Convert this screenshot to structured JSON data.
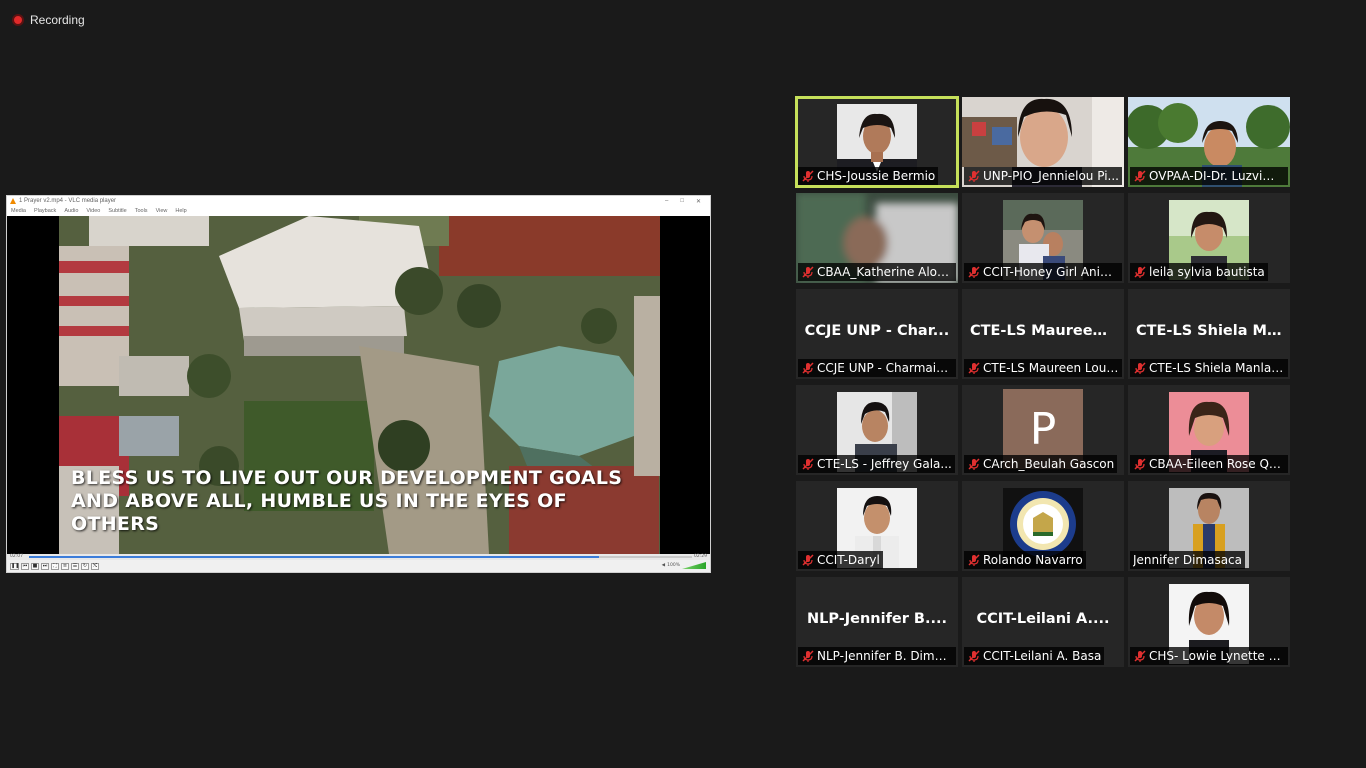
{
  "recording": {
    "label": "Recording"
  },
  "vlc": {
    "title": "1 Prayer v2.mp4 - VLC media player",
    "menus": [
      "Media",
      "Playback",
      "Audio",
      "Video",
      "Subtitle",
      "Tools",
      "View",
      "Help"
    ],
    "time_elapsed": "02:07",
    "time_total": "02:29",
    "progress_fraction": 0.86,
    "volume": "100%",
    "subtitle_line1": "BLESS US TO LIVE OUT OUR DEVELOPMENT GOALS",
    "subtitle_line2": "AND ABOVE ALL, HUMBLE US IN THE EYES OF OTHERS"
  },
  "gallery": {
    "tiles": [
      {
        "name": "CHS-Joussie Bermio"
      },
      {
        "name": "UNP-PIO_Jennielou Pi..."
      },
      {
        "name": "OVPAA-DI-Dr. Luzvimi..."
      },
      {
        "name": "CBAA_Katherine Alon-..."
      },
      {
        "name": "CCIT-Honey Girl Anin..."
      },
      {
        "name": "leila sylvia bautista"
      },
      {
        "name": "CCJE UNP - Charmain...",
        "center": "CCJE UNP - Char..."
      },
      {
        "name": "CTE-LS Maureen Lou ...",
        "center": "CTE-LS  Maureen..."
      },
      {
        "name": "CTE-LS Shiela Manlan...",
        "center": "CTE-LS  Shiela  M..."
      },
      {
        "name": "CTE-LS - Jeffrey Gala..."
      },
      {
        "name": "CArch_Beulah Gascon",
        "letter": "P"
      },
      {
        "name": "CBAA-Eileen Rose Qu..."
      },
      {
        "name": "CCIT-Daryl"
      },
      {
        "name": "Rolando Navarro",
        "seal_years": "1906 1965"
      },
      {
        "name": "Jennifer Dimasaca"
      },
      {
        "name": "NLP-Jennifer B. Dima...",
        "center": "NLP-Jennifer  B...."
      },
      {
        "name": "CCIT-Leilani A. Basa",
        "center": "CCIT-Leilani  A...."
      },
      {
        "name": "CHS- Lowie Lynette B..."
      }
    ]
  }
}
